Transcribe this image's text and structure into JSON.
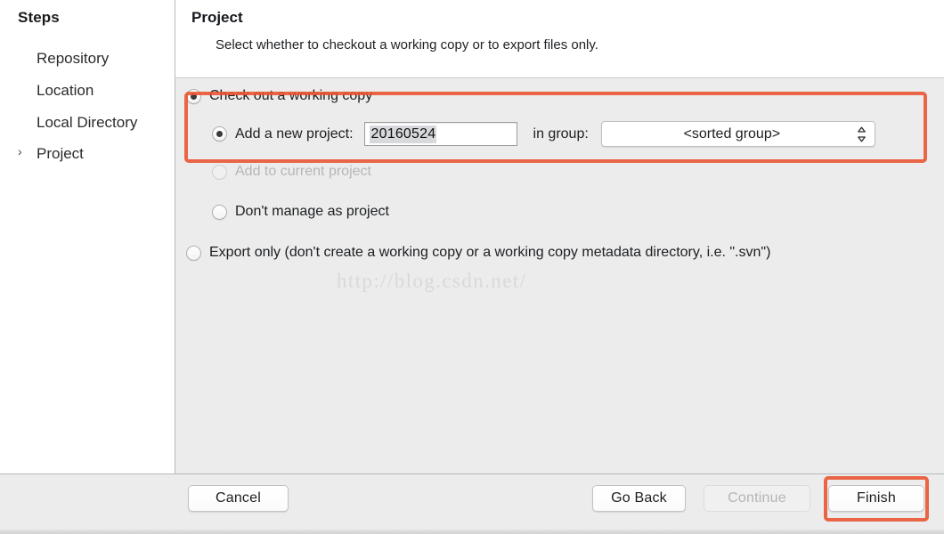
{
  "sidebar": {
    "title": "Steps",
    "items": [
      {
        "label": "Repository",
        "chevron": ""
      },
      {
        "label": "Location",
        "chevron": ""
      },
      {
        "label": "Local Directory",
        "chevron": ""
      },
      {
        "label": "Project",
        "chevron": "›"
      }
    ]
  },
  "header": {
    "title": "Project",
    "subtitle": "Select whether to checkout a working copy or to export files only."
  },
  "options": {
    "checkout": {
      "label": "Check out a working copy",
      "checked": true
    },
    "add_new_project": {
      "label": "Add a new project:",
      "checked": true,
      "field_value": "20160524",
      "field_placeholder": "",
      "in_group_label": "in group:",
      "group_selected": "<sorted group>",
      "group_options": [
        "<sorted group>"
      ],
      "stepper_icon": "chevron-up-down-icon"
    },
    "add_to_current": {
      "label": "Add to current project",
      "checked": false,
      "disabled": true
    },
    "dont_manage": {
      "label": "Don't manage as project",
      "checked": false,
      "disabled": false
    },
    "export_only": {
      "label": "Export only (don't create a working copy or a working copy metadata directory, i.e. \".svn\")",
      "checked": false,
      "disabled": false
    }
  },
  "watermark": {
    "text": "http://blog.csdn.net/"
  },
  "footer": {
    "cancel_label": "Cancel",
    "go_back_label": "Go Back",
    "continue_label": "Continue",
    "continue_disabled": true,
    "finish_label": "Finish"
  },
  "annotations": {
    "accent_color": "#e8522f",
    "boxes": [
      {
        "name": "checkout-option-highlight"
      },
      {
        "name": "finish-button-highlight"
      }
    ]
  }
}
